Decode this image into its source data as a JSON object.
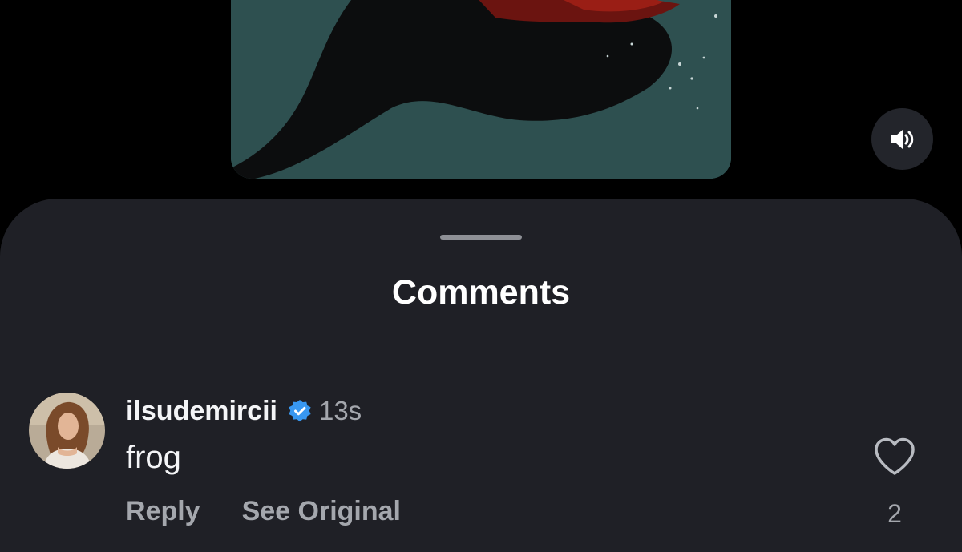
{
  "comments_sheet": {
    "title": "Comments"
  },
  "comment": {
    "username": "ilsudemircii",
    "verified": true,
    "timestamp": "13s",
    "text": "frog",
    "actions": {
      "reply_label": "Reply",
      "see_original_label": "See Original"
    },
    "like_count": "2"
  },
  "colors": {
    "sheet_background": "#1f2026",
    "primary_text": "#f4f5f7",
    "secondary_text": "#a4a7ad",
    "verified_badge": "#3897f0"
  },
  "icons": {
    "mute": "speaker-icon",
    "verified": "verified-badge-icon",
    "like": "heart-outline-icon"
  }
}
